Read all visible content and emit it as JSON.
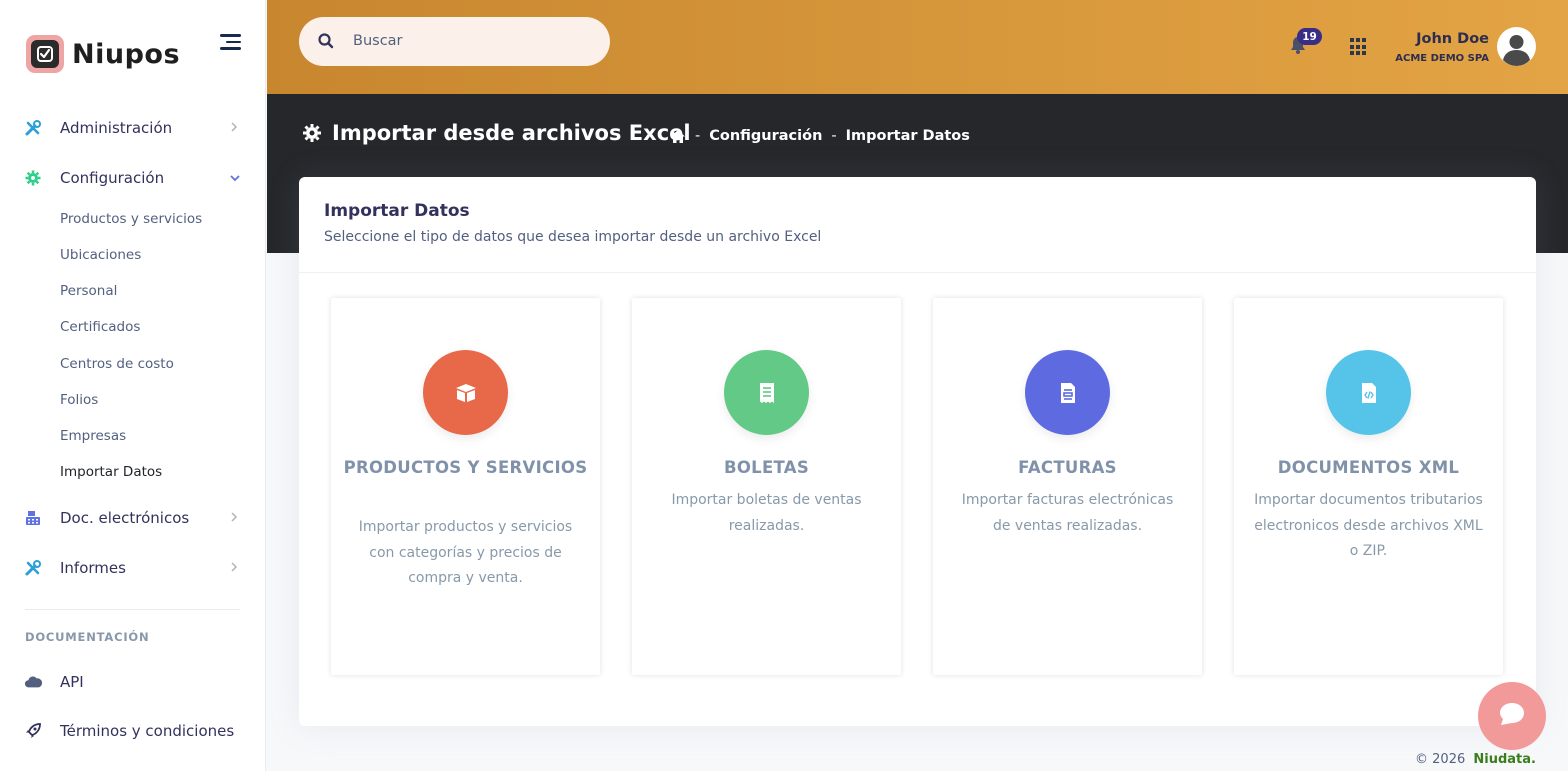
{
  "brand": {
    "name": "Niupos"
  },
  "sidebar": {
    "items": [
      {
        "label": "Administración"
      },
      {
        "label": "Configuración"
      },
      {
        "label": "Doc. electrónicos"
      },
      {
        "label": "Informes"
      }
    ],
    "sub_items": [
      {
        "label": "Productos y servicios"
      },
      {
        "label": "Ubicaciones"
      },
      {
        "label": "Personal"
      },
      {
        "label": "Certificados"
      },
      {
        "label": "Centros de costo"
      },
      {
        "label": "Folios"
      },
      {
        "label": "Empresas"
      },
      {
        "label": "Importar Datos"
      }
    ],
    "section_title": "DOCUMENTACIÓN",
    "doc_items": [
      {
        "label": "API"
      },
      {
        "label": "Términos y condiciones"
      }
    ]
  },
  "header": {
    "search_placeholder": "Buscar",
    "notifications_count": "19",
    "user_name": "John Doe",
    "user_company": "ACME DEMO SPA"
  },
  "page": {
    "title": "Importar desde archivos Excel",
    "breadcrumb": [
      "Configuración",
      "Importar Datos"
    ],
    "breadcrumb_sep": "-"
  },
  "card": {
    "title": "Importar Datos",
    "subtitle": "Seleccione el tipo de datos que desea importar desde un archivo Excel"
  },
  "options": [
    {
      "title": "PRODUCTOS Y SERVICIOS",
      "desc": "Importar productos y servicios con categorías y precios de compra y venta.",
      "color": "#e8684a",
      "icon": "box-icon"
    },
    {
      "title": "BOLETAS",
      "desc": "Importar boletas de ventas realizadas.",
      "color": "#62c987",
      "icon": "receipt-icon"
    },
    {
      "title": "FACTURAS",
      "desc": "Importar facturas electrónicas de ventas realizadas.",
      "color": "#5e6be0",
      "icon": "invoice-icon"
    },
    {
      "title": "DOCUMENTOS XML",
      "desc": "Importar documentos tributarios electronicos desde archivos XML o ZIP.",
      "color": "#56c4e9",
      "icon": "file-code-icon"
    }
  ],
  "footer": {
    "copyright": "© 2026",
    "brand": "Niudata."
  },
  "colors": {
    "topbar_start": "#c8872f",
    "topbar_end": "#e3a445",
    "band": "#25272b",
    "chat": "#f29a9a"
  }
}
